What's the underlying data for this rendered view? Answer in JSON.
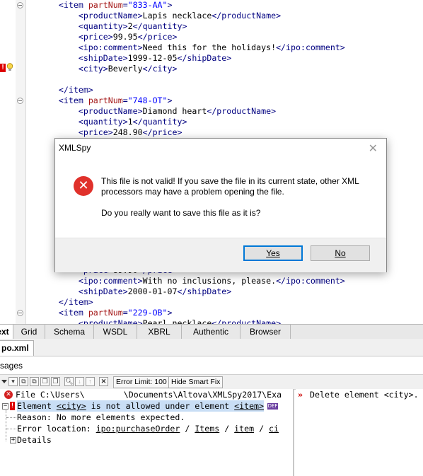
{
  "editor": {
    "lines": [
      {
        "indent": "    ",
        "parts": [
          {
            "c": "tag",
            "t": "<item "
          },
          {
            "c": "attr",
            "t": "partNum"
          },
          {
            "c": "tag",
            "t": "="
          },
          {
            "c": "aval",
            "t": "\"833-AA\""
          },
          {
            "c": "tag",
            "t": ">"
          }
        ]
      },
      {
        "indent": "        ",
        "parts": [
          {
            "c": "tag",
            "t": "<productName>"
          },
          {
            "c": "txt",
            "t": "Lapis necklace"
          },
          {
            "c": "tag",
            "t": "</productName>"
          }
        ]
      },
      {
        "indent": "        ",
        "parts": [
          {
            "c": "tag",
            "t": "<quantity>"
          },
          {
            "c": "txt",
            "t": "2"
          },
          {
            "c": "tag",
            "t": "</quantity>"
          }
        ]
      },
      {
        "indent": "        ",
        "parts": [
          {
            "c": "tag",
            "t": "<price>"
          },
          {
            "c": "txt",
            "t": "99.95"
          },
          {
            "c": "tag",
            "t": "</price>"
          }
        ]
      },
      {
        "indent": "        ",
        "parts": [
          {
            "c": "tag",
            "t": "<ipo:comment>"
          },
          {
            "c": "txt",
            "t": "Need this for the holidays!"
          },
          {
            "c": "tag",
            "t": "</ipo:comment>"
          }
        ]
      },
      {
        "indent": "        ",
        "parts": [
          {
            "c": "tag",
            "t": "<shipDate>"
          },
          {
            "c": "txt",
            "t": "1999-12-05"
          },
          {
            "c": "tag",
            "t": "</shipDate>"
          }
        ]
      },
      {
        "indent": "        ",
        "parts": [
          {
            "c": "tag",
            "t": "<city>"
          },
          {
            "c": "txt",
            "t": "Beverly"
          },
          {
            "c": "tag",
            "t": "</city>"
          }
        ]
      },
      {
        "indent": "",
        "parts": []
      },
      {
        "indent": "    ",
        "parts": [
          {
            "c": "tag",
            "t": "</item>"
          }
        ]
      },
      {
        "indent": "    ",
        "parts": [
          {
            "c": "tag",
            "t": "<item "
          },
          {
            "c": "attr",
            "t": "partNum"
          },
          {
            "c": "tag",
            "t": "="
          },
          {
            "c": "aval",
            "t": "\"748-OT\""
          },
          {
            "c": "tag",
            "t": ">"
          }
        ]
      },
      {
        "indent": "        ",
        "parts": [
          {
            "c": "tag",
            "t": "<productName>"
          },
          {
            "c": "txt",
            "t": "Diamond heart"
          },
          {
            "c": "tag",
            "t": "</productName>"
          }
        ]
      },
      {
        "indent": "        ",
        "parts": [
          {
            "c": "tag",
            "t": "<quantity>"
          },
          {
            "c": "txt",
            "t": "1"
          },
          {
            "c": "tag",
            "t": "</quantity>"
          }
        ]
      },
      {
        "indent": "        ",
        "parts": [
          {
            "c": "tag",
            "t": "<price>"
          },
          {
            "c": "txt",
            "t": "248.90"
          },
          {
            "c": "tag",
            "t": "</price>"
          }
        ]
      }
    ],
    "lines_bottom": [
      {
        "indent": "        ",
        "parts": [
          {
            "c": "tag",
            "t": "<price>"
          },
          {
            "c": "txt",
            "t": "89.90"
          },
          {
            "c": "tag",
            "t": "</price>"
          }
        ]
      },
      {
        "indent": "        ",
        "parts": [
          {
            "c": "tag",
            "t": "<ipo:comment>"
          },
          {
            "c": "txt",
            "t": "With no inclusions, please."
          },
          {
            "c": "tag",
            "t": "</ipo:comment>"
          }
        ]
      },
      {
        "indent": "        ",
        "parts": [
          {
            "c": "tag",
            "t": "<shipDate>"
          },
          {
            "c": "txt",
            "t": "2000-01-07"
          },
          {
            "c": "tag",
            "t": "</shipDate>"
          }
        ]
      },
      {
        "indent": "    ",
        "parts": [
          {
            "c": "tag",
            "t": "</item>"
          }
        ]
      },
      {
        "indent": "    ",
        "parts": [
          {
            "c": "tag",
            "t": "<item "
          },
          {
            "c": "attr",
            "t": "partNum"
          },
          {
            "c": "tag",
            "t": "="
          },
          {
            "c": "aval",
            "t": "\"229-OB\""
          },
          {
            "c": "tag",
            "t": ">"
          }
        ]
      },
      {
        "indent": "        ",
        "parts": [
          {
            "c": "tag",
            "t": "<productName>"
          },
          {
            "c": "txt",
            "t": "Pearl necklace"
          },
          {
            "c": "tag",
            "t": "</productName>"
          }
        ]
      }
    ]
  },
  "view_tabs": [
    "ext",
    "Grid",
    "Schema",
    "WSDL",
    "XBRL",
    "Authentic",
    "Browser"
  ],
  "active_view_tab": "ext",
  "doc_tab": "po.xml *",
  "messages_title": "sages",
  "toolbar": {
    "error_limit_label": "Error Limit: 100",
    "hide_smart_fix_label": "Hide Smart Fix"
  },
  "messages": {
    "file_prefix": "File C:\\Users\\",
    "file_suffix": "\\Documents\\Altova\\XMLSpy2017\\Exa",
    "error_text_1": "Element ",
    "error_elem": "<city>",
    "error_text_2": " is not allowed under element ",
    "error_parent": "<item>",
    "reason": "Reason: No more elements expected.",
    "location_label": "Error location: ",
    "location_path": [
      "ipo:purchaseOrder",
      "Items",
      "item",
      "ci"
    ],
    "details": "Details"
  },
  "smart_fix": {
    "text": "Delete element <city>."
  },
  "dialog": {
    "title": "XMLSpy",
    "message_1": "This file is not valid! If you save the file in its current state, other XML processors may have a problem opening the file.",
    "message_2": "Do you really want to save this file as it is?",
    "yes_label": "Yes",
    "no_label": "No"
  }
}
